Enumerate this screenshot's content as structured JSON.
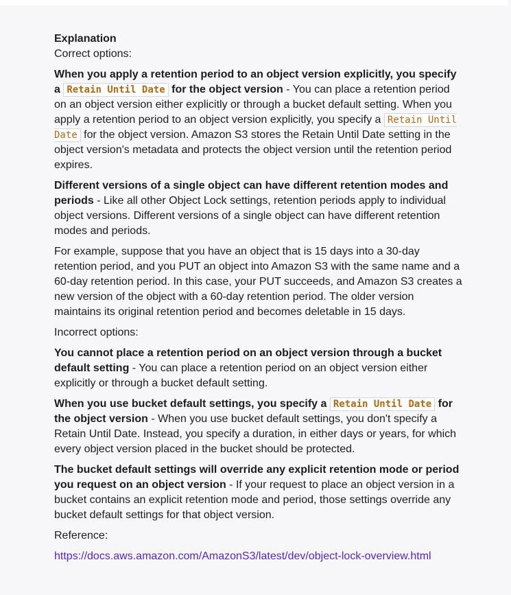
{
  "explanation": {
    "heading": "Explanation",
    "correct_label": "Correct options:",
    "p1": {
      "b1": "When you apply a retention period to an object version explicitly, you specify a",
      "code": "Retain Until Date",
      "b2": "for the object version",
      "t1": " - You can place a retention period on an object version either explicitly or through a bucket default setting. When you apply a retention period to an object version explicitly, you specify a ",
      "code2": "Retain Until Date",
      "t2": " for the object version. Amazon S3 stores the Retain Until Date setting in the object version's metadata and protects the object version until the retention period expires."
    },
    "p2": {
      "b1": "Different versions of a single object can have different retention modes and periods",
      "t1": " - Like all other Object Lock settings, retention periods apply to individual object versions. Different versions of a single object can have different retention modes and periods."
    },
    "p3": "For example, suppose that you have an object that is 15 days into a 30-day retention period, and you PUT an object into Amazon S3 with the same name and a 60-day retention period. In this case, your PUT succeeds, and Amazon S3 creates a new version of the object with a 60-day retention period. The older version maintains its original retention period and becomes deletable in 15 days.",
    "incorrect_label": "Incorrect options:",
    "p4": {
      "b1": "You cannot place a retention period on an object version through a bucket default setting",
      "t1": " - You can place a retention period on an object version either explicitly or through a bucket default setting."
    },
    "p5": {
      "b1": "When you use bucket default settings, you specify a",
      "code": "Retain Until Date",
      "b2": "for the object version",
      "t1": " - When you use bucket default settings, you don't specify a Retain Until Date. Instead, you specify a duration, in either days or years, for which every object version placed in the bucket should be protected."
    },
    "p6": {
      "b1": "The bucket default settings will override any explicit retention mode or period you request on an object version",
      "t1": " - If your request to place an object version in a bucket contains an explicit retention mode and period, those settings override any bucket default settings for that object version."
    },
    "reference_label": "Reference:",
    "reference_url": "https://docs.aws.amazon.com/AmazonS3/latest/dev/object-lock-overview.html"
  }
}
